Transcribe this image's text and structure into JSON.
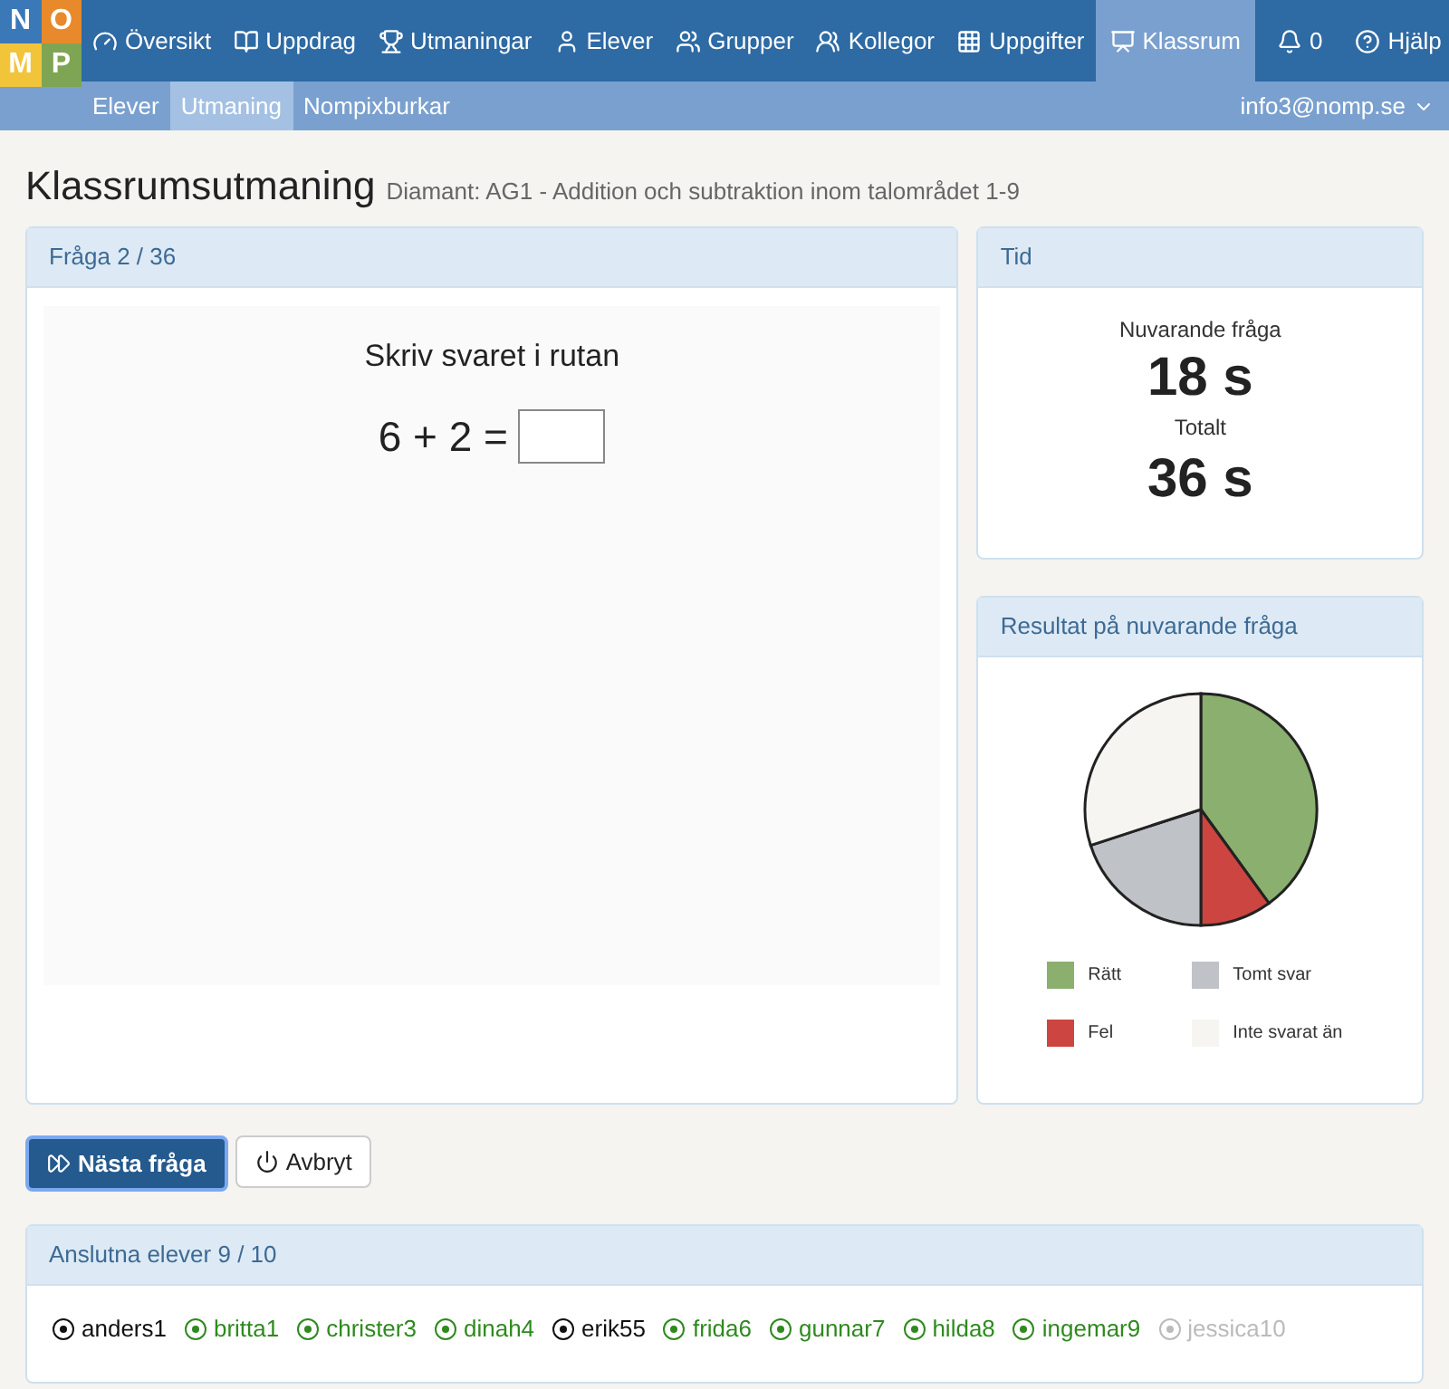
{
  "logo": {
    "letters": [
      {
        "char": "N",
        "color": "#3a78b8"
      },
      {
        "char": "O",
        "color": "#e8892b"
      },
      {
        "char": "M",
        "color": "#f2c43a"
      },
      {
        "char": "P",
        "color": "#7ea553"
      }
    ]
  },
  "nav": [
    {
      "label": "Översikt",
      "selected": false
    },
    {
      "label": "Uppdrag",
      "selected": false
    },
    {
      "label": "Utmaningar",
      "selected": false
    },
    {
      "label": "Elever",
      "selected": false
    },
    {
      "label": "Grupper",
      "selected": false
    },
    {
      "label": "Kollegor",
      "selected": false
    },
    {
      "label": "Uppgifter",
      "selected": false
    },
    {
      "label": "Klassrum",
      "selected": true
    },
    {
      "label": "0",
      "selected": false
    },
    {
      "label": "Hjälp",
      "selected": false
    }
  ],
  "subnav": [
    {
      "label": "Elever",
      "selected": false
    },
    {
      "label": "Utmaning",
      "selected": true
    },
    {
      "label": "Nompixburkar",
      "selected": false
    }
  ],
  "account": "info3@nomp.se",
  "page": {
    "title": "Klassrumsutmaning",
    "subtitle": "Diamant: AG1 - Addition och subtraktion inom talområdet 1-9"
  },
  "question_panel": {
    "header": "Fråga 2 / 36",
    "instruction": "Skriv svaret i rutan",
    "expression": "6 + 2 ="
  },
  "time_panel": {
    "header": "Tid",
    "current_label": "Nuvarande fråga",
    "current_value": "18 s",
    "total_label": "Totalt",
    "total_value": "36 s"
  },
  "result_panel": {
    "header": "Resultat på nuvarande fråga",
    "chart_data": {
      "type": "pie",
      "categories": [
        "Rätt",
        "Fel",
        "Tomt svar",
        "Inte svarat än"
      ],
      "values": [
        40,
        10,
        20,
        30
      ],
      "colors": [
        "#8aaf6e",
        "#cc4540",
        "#bfc3c7",
        "#f6f5f1"
      ]
    }
  },
  "buttons": [
    {
      "label": "Nästa fråga",
      "kind": "primary"
    },
    {
      "label": "Avbryt",
      "kind": "secondary"
    }
  ],
  "students_panel": {
    "header": "Anslutna elever 9 / 10",
    "students": [
      {
        "name": "anders1",
        "color": "#111111"
      },
      {
        "name": "britta1",
        "color": "#2e8a1e"
      },
      {
        "name": "christer3",
        "color": "#2e8a1e"
      },
      {
        "name": "dinah4",
        "color": "#2e8a1e"
      },
      {
        "name": "erik55",
        "color": "#111111"
      },
      {
        "name": "frida6",
        "color": "#2e8a1e"
      },
      {
        "name": "gunnar7",
        "color": "#2e8a1e"
      },
      {
        "name": "hilda8",
        "color": "#2e8a1e"
      },
      {
        "name": "ingemar9",
        "color": "#2e8a1e"
      },
      {
        "name": "jessica10",
        "color": "#bbbbbb"
      }
    ]
  }
}
